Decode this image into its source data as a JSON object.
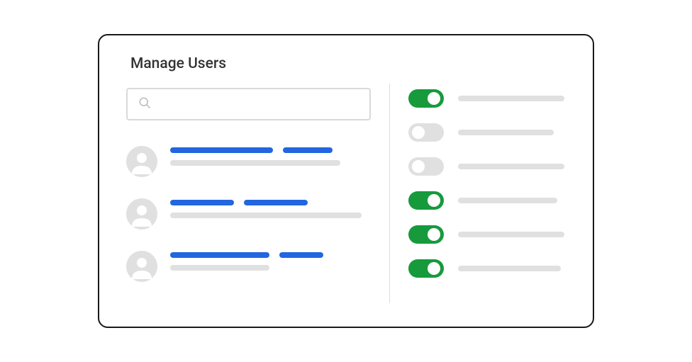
{
  "panel": {
    "title": "Manage Users"
  },
  "search": {
    "placeholder": "",
    "value": "",
    "icon": "search-icon"
  },
  "users": [
    {
      "name_bar_widths": [
        145,
        70
      ],
      "secondary_bar_width": 240
    },
    {
      "name_bar_widths": [
        90,
        90
      ],
      "secondary_bar_width": 270
    },
    {
      "name_bar_widths": [
        140,
        62
      ],
      "secondary_bar_width": 140
    }
  ],
  "toggles": [
    {
      "state": "on",
      "label_width": 150
    },
    {
      "state": "off",
      "label_width": 135
    },
    {
      "state": "off",
      "label_width": 150
    },
    {
      "state": "on",
      "label_width": 140
    },
    {
      "state": "on",
      "label_width": 150
    },
    {
      "state": "on",
      "label_width": 145
    }
  ],
  "colors": {
    "accent_blue": "#2266e0",
    "toggle_on": "#169a3c",
    "toggle_off": "#e0e0e0",
    "placeholder_gray": "#e0e0e0"
  }
}
